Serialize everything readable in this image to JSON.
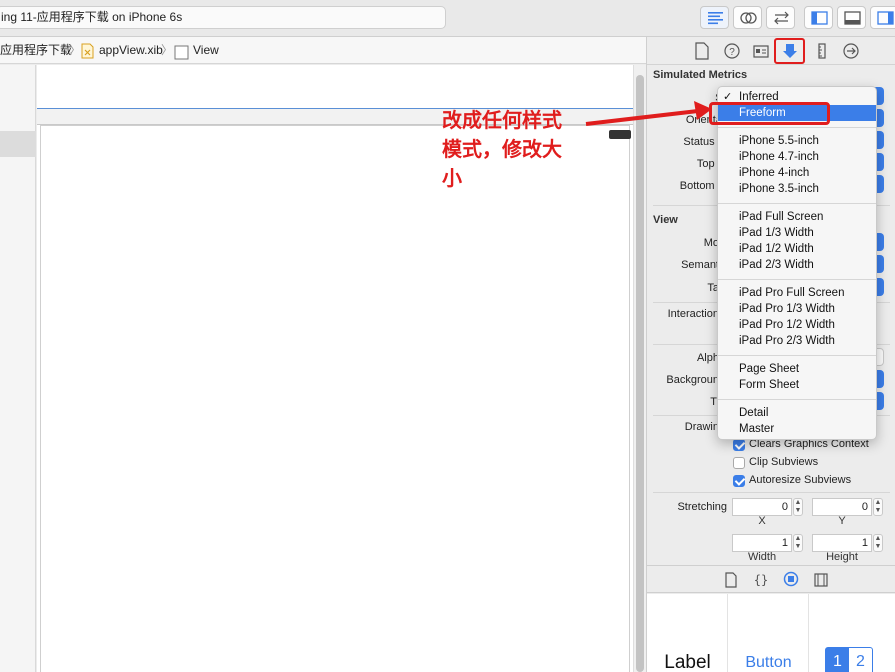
{
  "toolbar": {
    "status": "ing 11-应用程序下载 on iPhone 6s"
  },
  "jumpbar": {
    "crumb1": "应用程序下载",
    "crumb2": "appView.xib",
    "crumb3": "View"
  },
  "annotation": {
    "line1": "改成任何样式",
    "line2": "模式，修改大",
    "line3": "小"
  },
  "inspector": {
    "simulated_metrics": "Simulated Metrics",
    "labels": {
      "size": "Si",
      "orientation": "Orientat",
      "status_bar": "Status B",
      "top_bar": "Top B",
      "bottom_bar": "Bottom B"
    },
    "view_section": "View",
    "view_labels": {
      "mode": "Mo",
      "semantic": "Semant",
      "tag": "Ta",
      "interaction": "Interaction",
      "alpha": "Alph",
      "background": "Backgroun",
      "tint": "Ti",
      "drawing": "Drawin"
    },
    "checkboxes": [
      {
        "label": "Clears Graphics Context",
        "checked": true
      },
      {
        "label": "Clip Subviews",
        "checked": false
      },
      {
        "label": "Autoresize Subviews",
        "checked": true
      }
    ],
    "stretching": {
      "label": "Stretching",
      "x_value": "0",
      "y_value": "0",
      "x_caption": "X",
      "y_caption": "Y",
      "width_value": "1",
      "height_value": "1",
      "width_caption": "Width",
      "height_caption": "Height"
    }
  },
  "size_menu": {
    "selected": "Inferred",
    "highlighted": "Freeform",
    "groups": [
      [
        "Inferred",
        "Freeform"
      ],
      [
        "iPhone 5.5-inch",
        "iPhone 4.7-inch",
        "iPhone 4-inch",
        "iPhone 3.5-inch"
      ],
      [
        "iPad Full Screen",
        "iPad 1/3 Width",
        "iPad 1/2 Width",
        "iPad 2/3 Width"
      ],
      [
        "iPad Pro Full Screen",
        "iPad Pro 1/3 Width",
        "iPad Pro 1/2 Width",
        "iPad Pro 2/3 Width"
      ],
      [
        "Page Sheet",
        "Form Sheet"
      ],
      [
        "Detail",
        "Master"
      ]
    ]
  },
  "library": {
    "label": "Label",
    "button": "Button",
    "seg1": "1",
    "seg2": "2"
  },
  "colors": {
    "accent": "#3b7ee8",
    "annotation": "#e01d1d"
  }
}
